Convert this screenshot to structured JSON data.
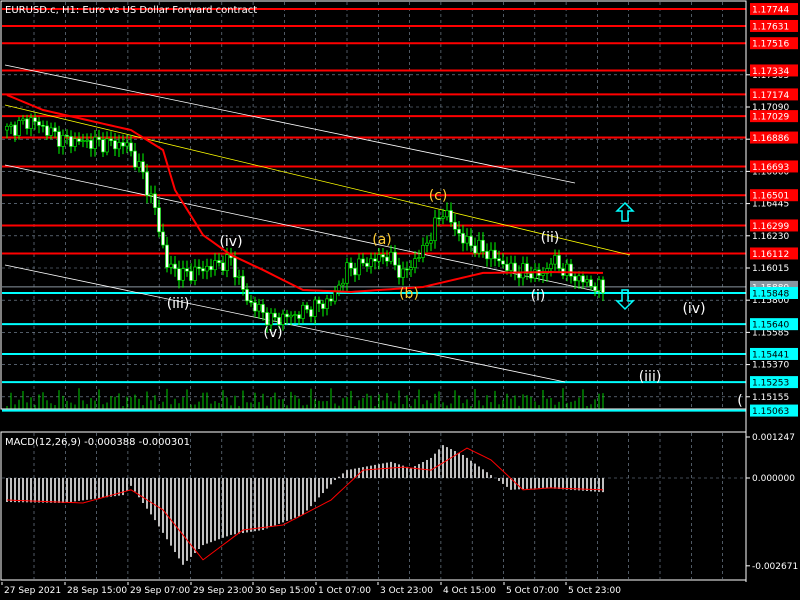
{
  "title": "EURUSD.c, H1:  Euro vs US Dollar Forward contract",
  "colors": {
    "background": "#000000",
    "grid": "#8494a6",
    "candle": "#00ff00",
    "ma": "#ff0000",
    "resistance": "#ff0000",
    "support": "#00ffff",
    "channel": "#ffffff",
    "trend": "#ffff00",
    "macd_hist": "#c0c0c0",
    "macd_signal": "#ff0000",
    "bid": "#8a96a0"
  },
  "chart_data": [
    {
      "type": "candlestick",
      "name_text": "EURUSD.c, H1",
      "price_ticks": [
        "1.17305",
        "1.17090",
        "1.16875",
        "1.16660",
        "1.16445",
        "1.16230",
        "1.16015",
        "1.15800",
        "1.15585",
        "1.15370",
        "1.15155"
      ],
      "resistance_levels": [
        "1.17744",
        "1.17631",
        "1.17516",
        "1.17334",
        "1.17174",
        "1.17029",
        "1.16886",
        "1.16693",
        "1.16501",
        "1.16299",
        "1.16112"
      ],
      "support_levels": [
        "1.15848",
        "1.15640",
        "1.15441",
        "1.15253",
        "1.15063"
      ],
      "bid_label": "1.15889",
      "time_labels": [
        "27 Sep 2021",
        "28 Sep 15:00",
        "29 Sep 07:00",
        "29 Sep 23:00",
        "30 Sep 15:00",
        "1 Oct 07:00",
        "3 Oct 23:00",
        "4 Oct 15:00",
        "5 Oct 07:00",
        "5 Oct 23:00"
      ],
      "close_path": [
        [
          0,
          1.16936
        ],
        [
          6,
          1.17003
        ],
        [
          14,
          1.1687
        ],
        [
          30,
          1.16836
        ],
        [
          34,
          1.16636
        ],
        [
          37,
          1.16402
        ],
        [
          40,
          1.16035
        ],
        [
          44,
          1.15968
        ],
        [
          56,
          1.16068
        ],
        [
          60,
          1.15801
        ],
        [
          66,
          1.15668
        ],
        [
          72,
          1.15701
        ],
        [
          81,
          1.15801
        ],
        [
          85,
          1.16002
        ],
        [
          95,
          1.16102
        ],
        [
          99,
          1.15968
        ],
        [
          104,
          1.16135
        ],
        [
          109,
          1.16402
        ],
        [
          114,
          1.16202
        ],
        [
          121,
          1.16102
        ],
        [
          126,
          1.16002
        ],
        [
          134,
          1.15968
        ],
        [
          136,
          1.16068
        ],
        [
          141,
          1.15968
        ],
        [
          149,
          1.15868
        ]
      ],
      "moving_average": [
        [
          0,
          1.1717
        ],
        [
          9,
          1.1707
        ],
        [
          31,
          1.16936
        ],
        [
          39,
          1.16803
        ],
        [
          42,
          1.16536
        ],
        [
          49,
          1.16235
        ],
        [
          56,
          1.16102
        ],
        [
          64,
          1.16002
        ],
        [
          74,
          1.15868
        ],
        [
          86,
          1.15855
        ],
        [
          104,
          1.15888
        ],
        [
          119,
          1.15982
        ],
        [
          136,
          1.15988
        ],
        [
          149,
          1.15982
        ]
      ],
      "wave_labels": [
        {
          "text": "(a)",
          "color": "#ffcc33"
        },
        {
          "text": "(b)",
          "color": "#ffcc33"
        },
        {
          "text": "(c)",
          "color": "#ffcc33"
        },
        {
          "text": "(i)",
          "color": "#ffffff"
        },
        {
          "text": "(ii)",
          "color": "#ffffff"
        },
        {
          "text": "(iii)",
          "color": "#ffffff"
        },
        {
          "text": "(iv)",
          "color": "#ffffff"
        },
        {
          "text": "(v)",
          "color": "#ffffff"
        },
        {
          "text": "(iv)",
          "color": "#ffffff"
        },
        {
          "text": "(iii)",
          "color": "#ffffff"
        },
        {
          "text": "(",
          "color": "#ffffff"
        }
      ]
    },
    {
      "type": "bar",
      "label": "MACD(12,26,9) -0.000388 -0.000301",
      "ticks": [
        "0.001247",
        "0.000000",
        "-0.002671"
      ],
      "ylim": [
        -0.002671,
        0.001247
      ],
      "histogram": [
        [
          0,
          -0.00073
        ],
        [
          14,
          -0.00076
        ],
        [
          29,
          -0.00052
        ],
        [
          31,
          -0.00024
        ],
        [
          37,
          -0.00128
        ],
        [
          44,
          -0.00264
        ],
        [
          49,
          -0.00204
        ],
        [
          56,
          -0.00173
        ],
        [
          64,
          -0.00158
        ],
        [
          74,
          -0.00112
        ],
        [
          82,
          -6e-05
        ],
        [
          85,
          0.00024
        ],
        [
          96,
          0.00049
        ],
        [
          101,
          0.0003
        ],
        [
          106,
          0.00061
        ],
        [
          109,
          0.001
        ],
        [
          114,
          0.0007
        ],
        [
          121,
          9e-05
        ],
        [
          126,
          -0.00036
        ],
        [
          134,
          -0.0003
        ],
        [
          149,
          -0.00043
        ]
      ],
      "signal": [
        [
          0,
          -0.00067
        ],
        [
          19,
          -0.00076
        ],
        [
          31,
          -0.00036
        ],
        [
          39,
          -0.00097
        ],
        [
          49,
          -0.00249
        ],
        [
          59,
          -0.00158
        ],
        [
          69,
          -0.00143
        ],
        [
          81,
          -0.00067
        ],
        [
          89,
          0.00024
        ],
        [
          99,
          0.00033
        ],
        [
          106,
          0.00024
        ],
        [
          115,
          0.00091
        ],
        [
          121,
          0.00055
        ],
        [
          129,
          -0.00036
        ],
        [
          136,
          -0.0003
        ],
        [
          149,
          -0.00036
        ]
      ]
    }
  ]
}
